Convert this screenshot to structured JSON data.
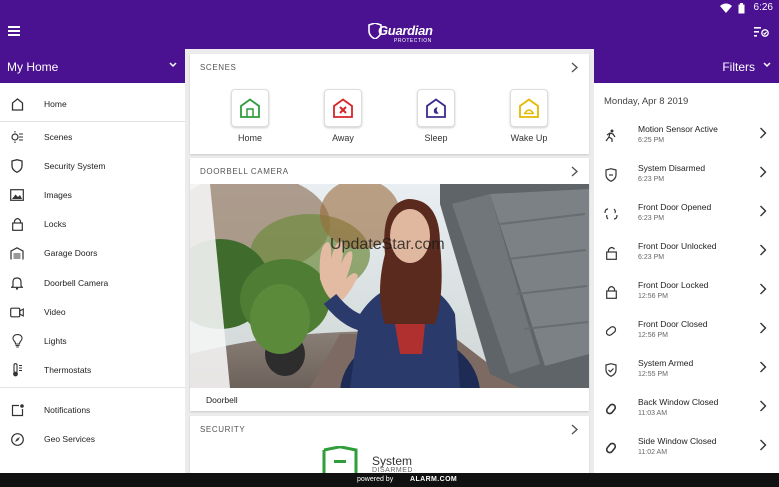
{
  "status_bar": {
    "time": "6:26"
  },
  "app_bar": {
    "logo_text": "Guardian",
    "logo_sub": "PROTECTION"
  },
  "sidebar": {
    "home_title": "My Home",
    "items": [
      {
        "label": "Home",
        "icon": "home-icon"
      },
      {
        "label": "Scenes",
        "icon": "scenes-icon"
      },
      {
        "label": "Security System",
        "icon": "shield-icon"
      },
      {
        "label": "Images",
        "icon": "image-icon"
      },
      {
        "label": "Locks",
        "icon": "lock-icon"
      },
      {
        "label": "Garage Doors",
        "icon": "garage-icon"
      },
      {
        "label": "Doorbell Camera",
        "icon": "bell-icon"
      },
      {
        "label": "Video",
        "icon": "video-icon"
      },
      {
        "label": "Lights",
        "icon": "bulb-icon"
      },
      {
        "label": "Thermostats",
        "icon": "thermometer-icon"
      },
      {
        "label": "Notifications",
        "icon": "notification-icon"
      },
      {
        "label": "Geo Services",
        "icon": "compass-icon"
      }
    ]
  },
  "scenes_card": {
    "title": "SCENES",
    "scenes": [
      {
        "name": "Home",
        "color": "#2e9d3a"
      },
      {
        "name": "Away",
        "color": "#d8232a"
      },
      {
        "name": "Sleep",
        "color": "#3b2a8c"
      },
      {
        "name": "Wake Up",
        "color": "#e6b800"
      }
    ]
  },
  "doorbell_card": {
    "title": "DOORBELL CAMERA",
    "caption": "Doorbell",
    "watermark": "UpdateStar.com"
  },
  "security_card": {
    "title": "SECURITY",
    "status_label": "System",
    "status_sub": "DISARMED"
  },
  "events_panel": {
    "title": "Filters",
    "date": "Monday, Apr 8 2019",
    "events": [
      {
        "title": "Motion Sensor Active",
        "time": "6:25 PM",
        "icon": "motion-icon"
      },
      {
        "title": "System Disarmed",
        "time": "6:23 PM",
        "icon": "shield-icon"
      },
      {
        "title": "Front Door Opened",
        "time": "6:23 PM",
        "icon": "door-open-icon"
      },
      {
        "title": "Front Door Unlocked",
        "time": "6:23 PM",
        "icon": "unlock-icon"
      },
      {
        "title": "Front Door Locked",
        "time": "12:56 PM",
        "icon": "lock-icon"
      },
      {
        "title": "Front Door Closed",
        "time": "12:56 PM",
        "icon": "door-closed-icon"
      },
      {
        "title": "System Armed",
        "time": "12:55 PM",
        "icon": "shield-check-icon"
      },
      {
        "title": "Back Window Closed",
        "time": "11:03 AM",
        "icon": "window-closed-icon"
      },
      {
        "title": "Side Window Closed",
        "time": "11:02 AM",
        "icon": "window-closed-icon"
      }
    ]
  },
  "footer": {
    "powered_by": "powered by",
    "brand": "ALARM.COM"
  },
  "colors": {
    "primary": "#4a1190",
    "text": "#222222"
  }
}
